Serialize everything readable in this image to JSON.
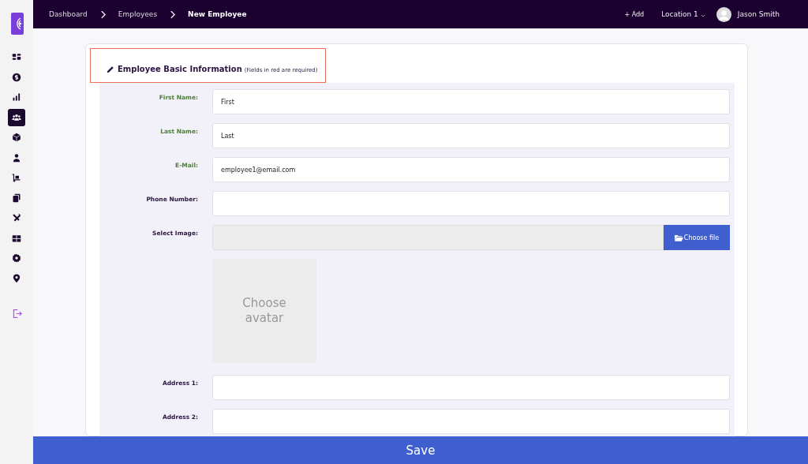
{
  "breadcrumbs": [
    {
      "label": "Dashboard",
      "current": false
    },
    {
      "label": "Employees",
      "current": false
    },
    {
      "label": "New Employee",
      "current": true
    }
  ],
  "topbar": {
    "add": "+ Add",
    "location": "Location 1",
    "user": "Jason Smith"
  },
  "sidebar": {
    "items": [
      {
        "selected": false
      },
      {
        "selected": false
      },
      {
        "selected": false
      },
      {
        "selected": true
      },
      {
        "selected": false
      },
      {
        "selected": false
      },
      {
        "selected": false
      },
      {
        "selected": false
      },
      {
        "selected": false
      },
      {
        "selected": false
      },
      {
        "selected": false
      },
      {
        "selected": false
      }
    ]
  },
  "form": {
    "title": "Employee Basic Information",
    "note": "(Fields in red are required)",
    "fields": [
      {
        "kind": "text",
        "label": "First Name:",
        "value": "First",
        "required": true
      },
      {
        "kind": "text",
        "label": "Last Name:",
        "value": "Last",
        "required": true
      },
      {
        "kind": "text",
        "label": "E-Mail:",
        "value": "employee1@email.com",
        "required": true
      },
      {
        "kind": "text",
        "label": "Phone Number:",
        "required": false
      },
      {
        "kind": "file",
        "label": "Select Image:",
        "button": "Choose file",
        "required": false
      },
      {
        "kind": "avatar",
        "text": "Choose avatar"
      },
      {
        "kind": "text",
        "label": "Address 1:",
        "required": false
      },
      {
        "kind": "text",
        "label": "Address 2:",
        "required": false
      }
    ]
  },
  "save_button": "Save"
}
